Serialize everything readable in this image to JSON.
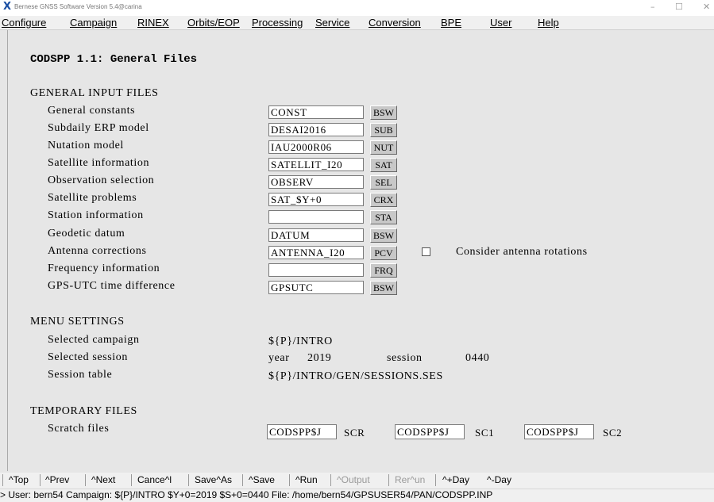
{
  "window": {
    "title": "Bernese GNSS Software Version 5.4@carina",
    "controls": {
      "minimize": "–",
      "maximize": "☐",
      "close": "✕"
    }
  },
  "menu": [
    "Configure",
    "Campaign",
    "RINEX",
    "Orbits/EOP",
    "Processing",
    "Service",
    "Conversion",
    "BPE",
    "User",
    "Help"
  ],
  "page": {
    "title": "CODSPP 1.1: General Files",
    "general_input": {
      "heading": "GENERAL INPUT FILES",
      "rows": [
        {
          "label": "General constants",
          "value": "CONST",
          "ext": "BSW"
        },
        {
          "label": "Subdaily ERP model",
          "value": "DESAI2016",
          "ext": "SUB"
        },
        {
          "label": "Nutation model",
          "value": "IAU2000R06",
          "ext": "NUT"
        },
        {
          "label": "Satellite information",
          "value": "SATELLIT_I20",
          "ext": "SAT"
        },
        {
          "label": "Observation selection",
          "value": "OBSERV",
          "ext": "SEL"
        },
        {
          "label": "Satellite problems",
          "value": "SAT_$Y+0",
          "ext": "CRX"
        },
        {
          "label": "Station information",
          "value": "",
          "ext": "STA"
        },
        {
          "label": "Geodetic datum",
          "value": "DATUM",
          "ext": "BSW"
        },
        {
          "label": "Antenna corrections",
          "value": "ANTENNA_I20",
          "ext": "PCV"
        },
        {
          "label": "Frequency information",
          "value": "",
          "ext": "FRQ"
        },
        {
          "label": "GPS-UTC time difference",
          "value": "GPSUTC",
          "ext": "BSW"
        }
      ],
      "antenna_rotation_checkbox": {
        "label": "Consider antenna rotations",
        "checked": false
      }
    },
    "menu_settings": {
      "heading": "MENU SETTINGS",
      "campaign_label": "Selected campaign",
      "campaign_value": "${P}/INTRO",
      "session_label": "Selected session",
      "year_label": "year",
      "year_value": "2019",
      "session_word": "session",
      "session_value": "0440",
      "table_label": "Session table",
      "table_value": "${P}/INTRO/GEN/SESSIONS.SES"
    },
    "temporary": {
      "heading": "TEMPORARY FILES",
      "scratch_label": "Scratch files",
      "files": [
        {
          "value": "CODSPP$J",
          "ext": "SCR"
        },
        {
          "value": "CODSPP$J",
          "ext": "SC1"
        },
        {
          "value": "CODSPP$J",
          "ext": "SC2"
        }
      ]
    }
  },
  "toolbar": {
    "top": "^Top",
    "prev": "^Prev",
    "next": "^Next",
    "cancel": "Cance^l",
    "save_as": "Save^As",
    "save": "^Save",
    "run": "^Run",
    "output": "^Output",
    "rerun": "Rer^un",
    "plus_day": "^+Day",
    "minus_day": "^-Day"
  },
  "status": "> User: bern54  Campaign: ${P}/INTRO  $Y+0=2019  $S+0=0440  File: /home/bern54/GPSUSER54/PAN/CODSPP.INP",
  "colors": {
    "background": "#e6e6e6",
    "field": "#ffffff",
    "ext_button": "#c8c8c8",
    "disabled_text": "#9a9a9a"
  }
}
